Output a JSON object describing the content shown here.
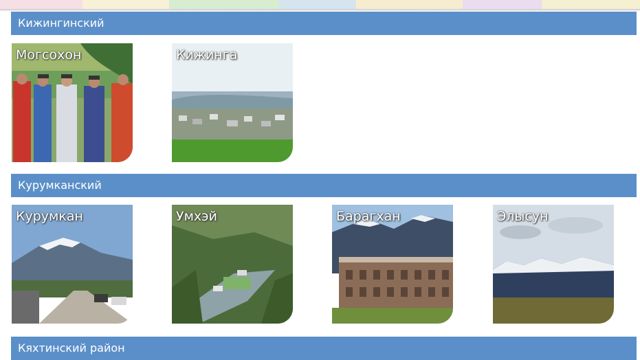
{
  "top_strip_colors": [
    "#f7dfe6",
    "#f9f0d8",
    "#d8ecd0",
    "#d6e4ef",
    "#f7ecd0",
    "#ecdcef",
    "#f5efd2"
  ],
  "accent_color": "#5b8fc9",
  "sections": [
    {
      "title": "Кижингинский",
      "places": [
        {
          "name": "Могсохон",
          "image": "people-in-traditional-dress"
        },
        {
          "name": "Кижинга",
          "image": "village-valley"
        }
      ]
    },
    {
      "title": "Курумканский",
      "places": [
        {
          "name": "Курумкан",
          "image": "snowy-mountain-street"
        },
        {
          "name": "Умхэй",
          "image": "resort-in-forest"
        },
        {
          "name": "Барагхан",
          "image": "building-under-mountains"
        },
        {
          "name": "Элысун",
          "image": "steppe-and-mountains"
        }
      ]
    },
    {
      "title": "Кяхтинский район",
      "places": []
    }
  ]
}
